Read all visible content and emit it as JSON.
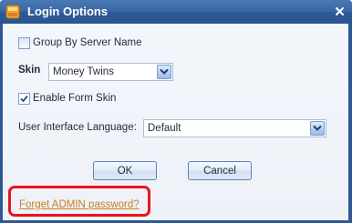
{
  "window": {
    "title": "Login Options"
  },
  "options": {
    "group_by_server_label": "Group By Server Name",
    "group_by_server_checked": false,
    "skin_label": "Skin",
    "skin_value": "Money Twins",
    "enable_form_skin_label": "Enable Form Skin",
    "enable_form_skin_checked": true,
    "ui_language_label": "User Interface Language:",
    "ui_language_value": "Default"
  },
  "buttons": {
    "ok_label": "OK",
    "cancel_label": "Cancel"
  },
  "footer": {
    "forgot_link": "Forget ADMIN password?"
  },
  "colors": {
    "titlebar": "#3a69a6",
    "link": "#c8801e",
    "highlight": "#e8141b"
  },
  "icons": {
    "app": "app-icon",
    "close": "close-icon",
    "check": "checkmark-icon",
    "dropdown": "chevron-down-icon"
  }
}
